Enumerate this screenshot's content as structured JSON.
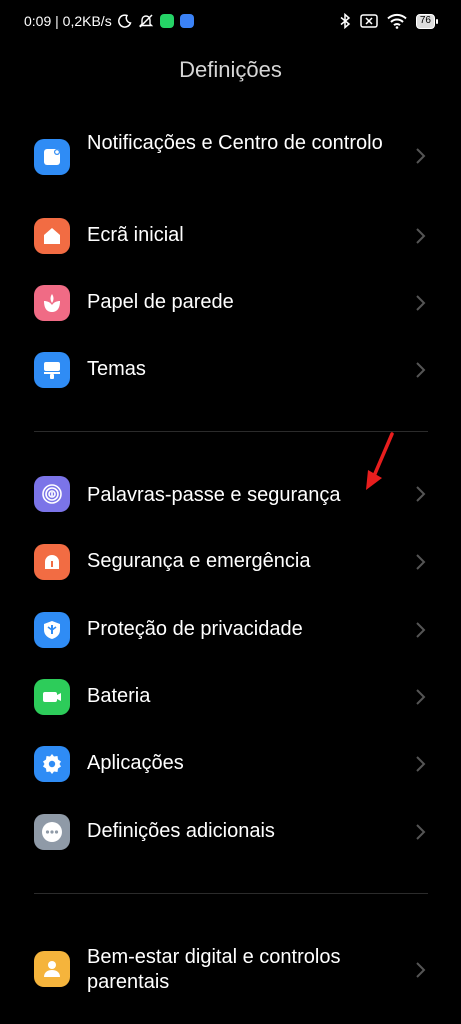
{
  "status_bar": {
    "time_speed": "0:09 | 0,2KB/s",
    "battery": "76",
    "colors": {
      "whatsapp": "#25d366",
      "app_badge": "#3b82f6"
    },
    "icons": [
      "moon-icon",
      "muted-bell-icon",
      "whatsapp-icon",
      "app-badge-icon",
      "bluetooth-icon",
      "no-sim-icon",
      "wifi-icon",
      "battery-icon"
    ]
  },
  "header": {
    "title": "Definições"
  },
  "groups": [
    {
      "items": [
        {
          "label": "Notificações e Centro de controlo",
          "icon": "notification-icon",
          "color": "#2f8cf5"
        },
        {
          "label": "Ecrã inicial",
          "icon": "home-icon",
          "color": "#f26c43"
        },
        {
          "label": "Papel de parede",
          "icon": "flower-icon",
          "color": "#f06b85"
        },
        {
          "label": "Temas",
          "icon": "brush-icon",
          "color": "#2f8cf5"
        }
      ]
    },
    {
      "items": [
        {
          "label": "Palavras-passe e segurança",
          "icon": "fingerprint-icon",
          "color": "#7b74e8"
        },
        {
          "label": "Segurança e emergência",
          "icon": "siren-icon",
          "color": "#f26c43"
        },
        {
          "label": "Proteção de privacidade",
          "icon": "shield-icon",
          "color": "#2f8cf5"
        },
        {
          "label": "Bateria",
          "icon": "battery-tile-icon",
          "color": "#2dcc5a"
        },
        {
          "label": "Aplicações",
          "icon": "gear-icon",
          "color": "#2f8cf5"
        },
        {
          "label": "Definições adicionais",
          "icon": "more-icon",
          "color": "#8f9aa7"
        }
      ]
    },
    {
      "items": [
        {
          "label": "Bem-estar digital e controlos parentais",
          "icon": "person-icon",
          "color": "#f5b43c"
        }
      ]
    }
  ],
  "annotation": {
    "color": "#e81e1e",
    "icon": "red-arrow-icon"
  }
}
